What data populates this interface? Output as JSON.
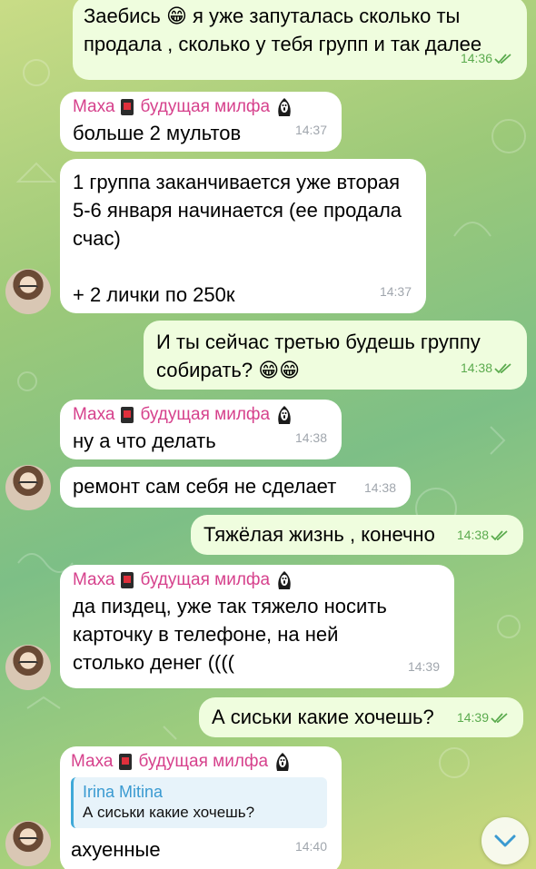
{
  "sender": {
    "name": "Маха",
    "title": "будущая милфа"
  },
  "messages": [
    {
      "dir": "out",
      "text": "Заебись 😁 я уже запуталась сколько ты продала , сколько у тебя групп и так далее",
      "time": "14:36"
    },
    {
      "dir": "in",
      "show_sender": true,
      "text": "больше 2 мультов",
      "time": "14:37"
    },
    {
      "dir": "in",
      "text": "1 группа заканчивается уже вторая 5-6 января начинается (ее продала счас)\n\n+ 2 лички по 250к",
      "time": "14:37"
    },
    {
      "dir": "out",
      "text": "И ты сейчас третью будешь группу собирать? 😁😁",
      "time": "14:38"
    },
    {
      "dir": "in",
      "show_sender": true,
      "text": "ну а что делать",
      "time": "14:38"
    },
    {
      "dir": "in",
      "text": "ремонт сам себя не сделает",
      "time": "14:38"
    },
    {
      "dir": "out",
      "text": "Тяжёлая жизнь , конечно",
      "time": "14:38"
    },
    {
      "dir": "in",
      "show_sender": true,
      "text": "да пиздец, уже так тяжело носить карточку в телефоне, на ней столько денег ((((",
      "time": "14:39"
    },
    {
      "dir": "out",
      "text": "А сиськи какие хочешь?",
      "time": "14:39"
    },
    {
      "dir": "in",
      "show_sender": true,
      "reply": {
        "name": "Irina Mitina",
        "text": "А сиськи какие хочешь?"
      },
      "text": "ахуенные",
      "time": "14:40"
    }
  ],
  "icons": {
    "sender_badge": "red-square-icon",
    "sender_emoji": "scream-mask-icon",
    "read_status": "double-check-icon",
    "scroll_down": "chevron-down-icon",
    "avatar": "user-avatar-photo"
  },
  "colors": {
    "out_bubble": "#effdde",
    "in_bubble": "#ffffff",
    "time_out": "#5bab4e",
    "sender_name": "#d6418c",
    "reply_accent": "#3a9ad1"
  }
}
